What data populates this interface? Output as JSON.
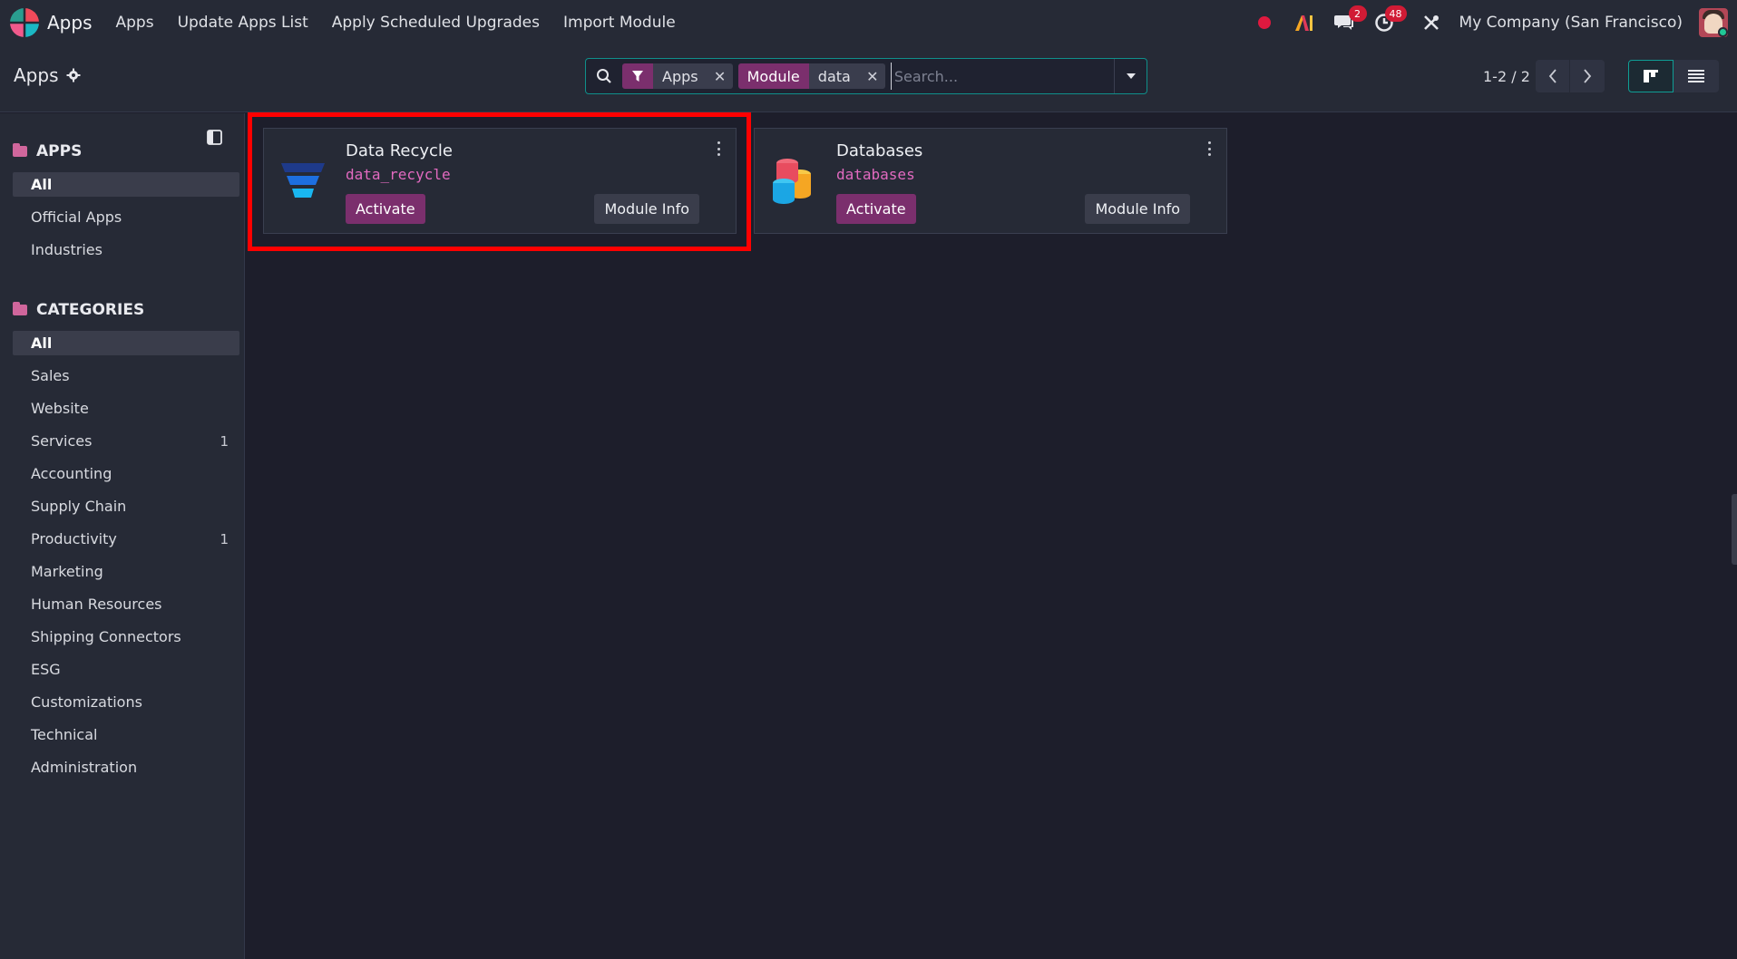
{
  "topbar": {
    "app_title": "Apps",
    "menu": [
      "Apps",
      "Update Apps List",
      "Apply Scheduled Upgrades",
      "Import Module"
    ],
    "messages_badge": "2",
    "activities_badge": "48",
    "company": "My Company (San Francisco)",
    "ai_label": "AI"
  },
  "control_panel": {
    "breadcrumb": "Apps",
    "search": {
      "facets": [
        {
          "label_icon": "filter-icon",
          "value": "Apps"
        },
        {
          "label": "Module",
          "value": "data"
        }
      ],
      "placeholder": "Search..."
    },
    "pager": "1-2 / 2"
  },
  "sidebar": {
    "apps_heading": "APPS",
    "apps_items": [
      {
        "label": "All",
        "active": true,
        "count": ""
      },
      {
        "label": "Official Apps",
        "count": ""
      },
      {
        "label": "Industries",
        "count": ""
      }
    ],
    "categories_heading": "CATEGORIES",
    "category_items": [
      {
        "label": "All",
        "active": true,
        "count": ""
      },
      {
        "label": "Sales",
        "count": ""
      },
      {
        "label": "Website",
        "count": ""
      },
      {
        "label": "Services",
        "count": "1"
      },
      {
        "label": "Accounting",
        "count": ""
      },
      {
        "label": "Supply Chain",
        "count": ""
      },
      {
        "label": "Productivity",
        "count": "1"
      },
      {
        "label": "Marketing",
        "count": ""
      },
      {
        "label": "Human Resources",
        "count": ""
      },
      {
        "label": "Shipping Connectors",
        "count": ""
      },
      {
        "label": "ESG",
        "count": ""
      },
      {
        "label": "Customizations",
        "count": ""
      },
      {
        "label": "Technical",
        "count": ""
      },
      {
        "label": "Administration",
        "count": ""
      }
    ]
  },
  "cards": [
    {
      "name": "Data Recycle",
      "technical_name": "data_recycle",
      "activate_label": "Activate",
      "info_label": "Module Info",
      "icon": "recycle-funnel-icon"
    },
    {
      "name": "Databases",
      "technical_name": "databases",
      "activate_label": "Activate",
      "info_label": "Module Info",
      "icon": "database-cylinders-icon"
    }
  ],
  "colors": {
    "accent": "#7b2f6d",
    "teal": "#0f9d95",
    "highlight": "#ff0000",
    "tech_name": "#e26ac0"
  }
}
